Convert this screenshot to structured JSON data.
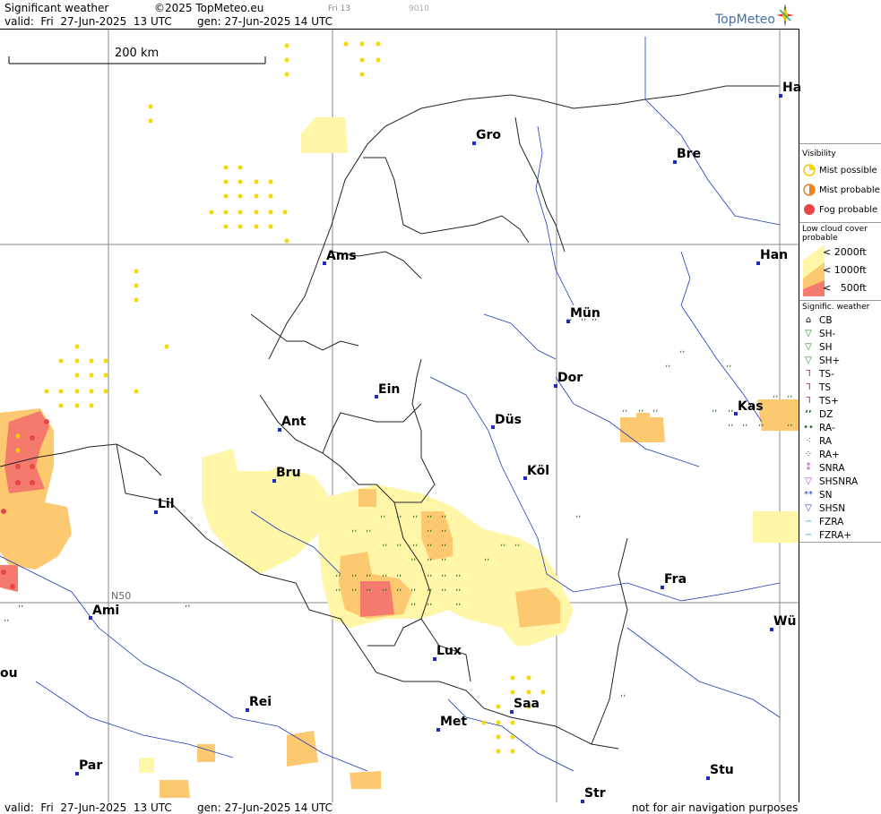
{
  "header": {
    "title": "Significant weather",
    "copyright": "©2025 TopMeteo.eu",
    "frame_label": "Fri 13",
    "code": "9010",
    "valid": "valid:  Fri  27-Jun-2025  13 UTC",
    "gen": "gen: 27-Jun-2025 14 UTC"
  },
  "logo": {
    "text": "TopMeteo"
  },
  "map": {
    "scale_label": "200 km",
    "lat_label": "N50",
    "cities": [
      {
        "name": "Gro"
      },
      {
        "name": "Bre"
      },
      {
        "name": "Ha"
      },
      {
        "name": "Ams"
      },
      {
        "name": "Han"
      },
      {
        "name": "Mün"
      },
      {
        "name": "Dor"
      },
      {
        "name": "Ein"
      },
      {
        "name": "Kas"
      },
      {
        "name": "Ant"
      },
      {
        "name": "Düs"
      },
      {
        "name": "Bru"
      },
      {
        "name": "Köl"
      },
      {
        "name": "Lil"
      },
      {
        "name": "Fra"
      },
      {
        "name": "Ami"
      },
      {
        "name": "Wü"
      },
      {
        "name": "Lux"
      },
      {
        "name": "ou"
      },
      {
        "name": "Rei"
      },
      {
        "name": "Saa"
      },
      {
        "name": "Met"
      },
      {
        "name": "Stu"
      },
      {
        "name": "Par"
      },
      {
        "name": "Str"
      }
    ]
  },
  "legend": {
    "visibility_title": "Visibility",
    "mist_possible": "Mist possible",
    "mist_probable": "Mist probable",
    "fog_probable": "Fog probable",
    "lowcloud_title": "Low cloud cover probable",
    "lowcloud_levels": [
      "< 2000ft",
      "< 1000ft",
      "<   500ft"
    ],
    "sigwx_title": "Signific. weather",
    "sigwx_items": [
      "CB",
      "SH-",
      "SH",
      "SH+",
      "TS-",
      "TS",
      "TS+",
      "DZ",
      "RA-",
      "RA",
      "RA+",
      "SNRA",
      "SHSNRA",
      "SN",
      "SHSN",
      "FZRA",
      "FZRA+"
    ],
    "colors": {
      "mist": "#f5d800",
      "fog": "#e84545",
      "lc2000": "#fff6a8",
      "lc1000": "#fcc870",
      "lc500": "#f37a6c"
    }
  },
  "footer": {
    "valid": "valid:  Fri  27-Jun-2025  13 UTC",
    "gen": "gen: 27-Jun-2025 14 UTC",
    "note": "not for air navigation purposes"
  }
}
